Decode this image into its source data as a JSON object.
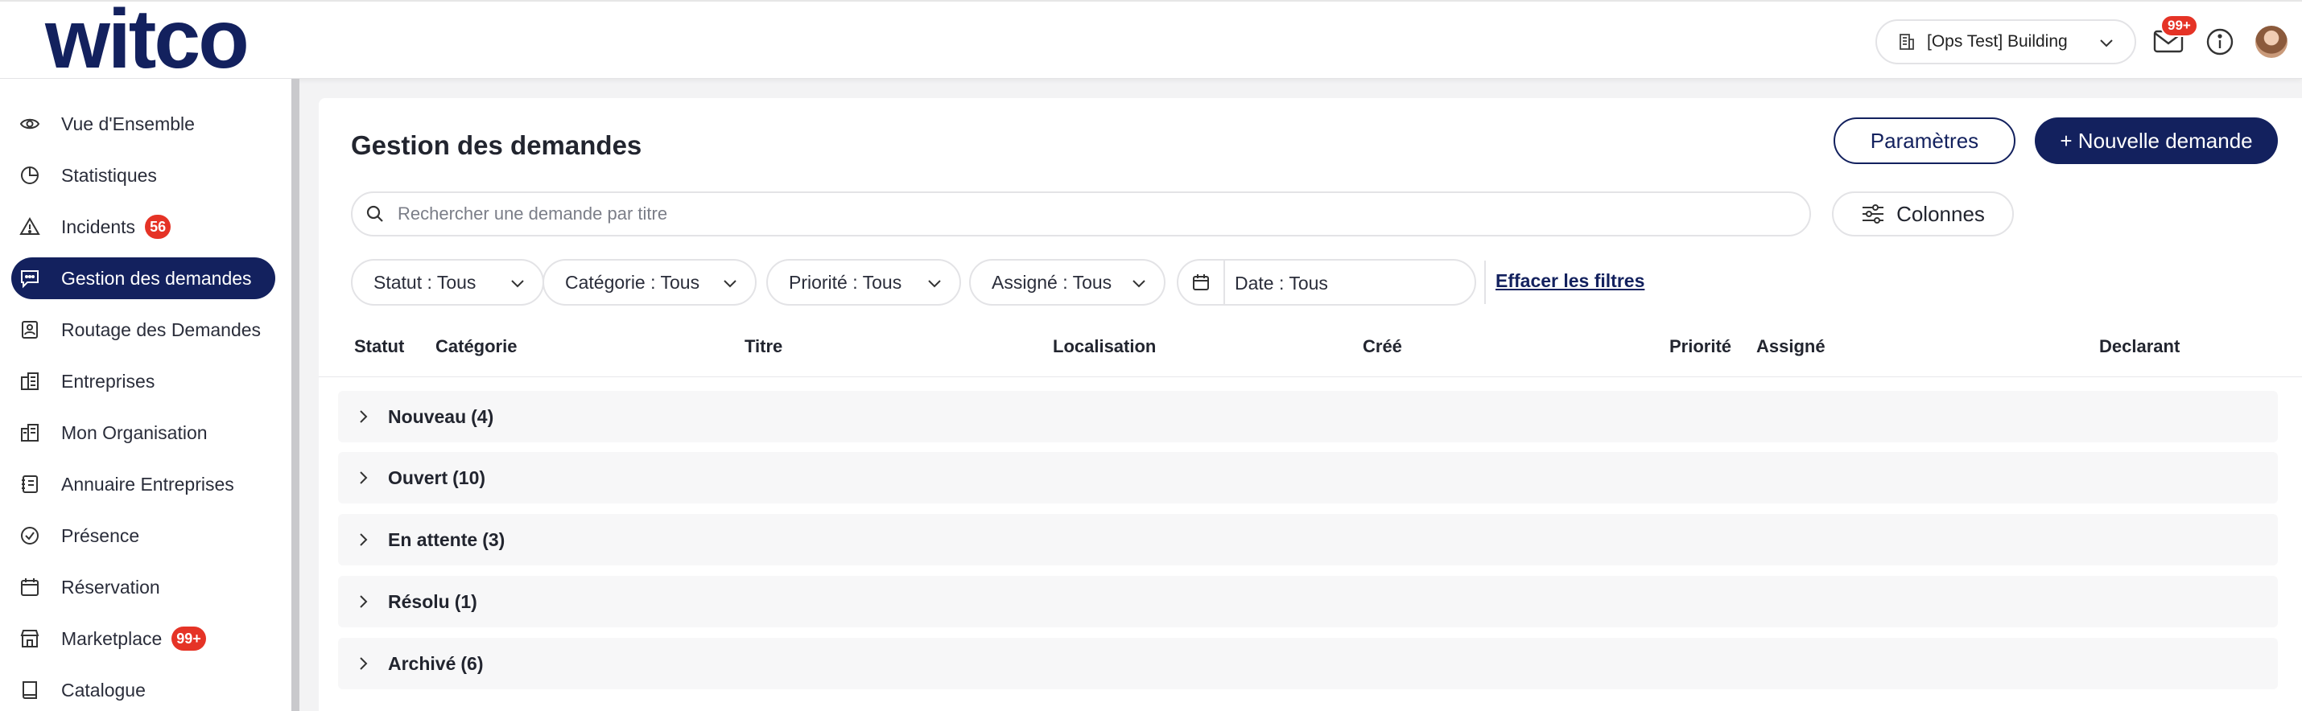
{
  "header": {
    "logo_text": "witco",
    "building_label": "[Ops Test] Building",
    "mail_badge": "99+"
  },
  "sidebar": {
    "items": [
      {
        "label": "Vue d'Ensemble",
        "icon": "eye-icon"
      },
      {
        "label": "Statistiques",
        "icon": "pie-chart-icon"
      },
      {
        "label": "Incidents",
        "icon": "warning-icon",
        "badge": "56"
      },
      {
        "label": "Gestion des demandes",
        "icon": "message-icon",
        "active": true
      },
      {
        "label": "Routage des Demandes",
        "icon": "routing-icon"
      },
      {
        "label": "Entreprises",
        "icon": "building-icon"
      },
      {
        "label": "Mon Organisation",
        "icon": "organisation-icon"
      },
      {
        "label": "Annuaire Entreprises",
        "icon": "directory-icon"
      },
      {
        "label": "Présence",
        "icon": "check-circle-icon"
      },
      {
        "label": "Réservation",
        "icon": "calendar-icon"
      },
      {
        "label": "Marketplace",
        "icon": "store-icon",
        "badge": "99+"
      },
      {
        "label": "Catalogue",
        "icon": "book-icon"
      }
    ]
  },
  "main": {
    "title": "Gestion des demandes",
    "params_button": "Paramètres",
    "new_button": "+ Nouvelle demande",
    "search_placeholder": "Rechercher une demande par titre",
    "columns_button": "Colonnes",
    "filters": {
      "status": "Statut : Tous",
      "category": "Catégorie : Tous",
      "priority": "Priorité : Tous",
      "assigned": "Assigné : Tous",
      "date": "Date : Tous",
      "clear": "Effacer les filtres"
    },
    "columns": [
      "Statut",
      "Catégorie",
      "Titre",
      "Localisation",
      "Créé",
      "Priorité",
      "Assigné",
      "Declarant"
    ],
    "groups": [
      {
        "label": "Nouveau",
        "count": "(4)"
      },
      {
        "label": "Ouvert",
        "count": "(10)"
      },
      {
        "label": "En attente",
        "count": "(3)"
      },
      {
        "label": "Résolu",
        "count": "(1)"
      },
      {
        "label": "Archivé",
        "count": "(6)"
      }
    ]
  }
}
